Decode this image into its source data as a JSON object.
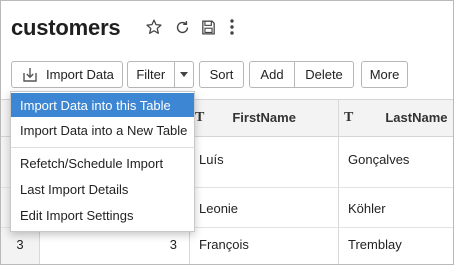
{
  "header": {
    "title": "customers",
    "icons": [
      "star-icon",
      "refresh-icon",
      "save-icon",
      "more-vertical-icon"
    ]
  },
  "toolbar": {
    "import_label": "Import Data",
    "filter_label": "Filter",
    "sort_label": "Sort",
    "add_label": "Add",
    "delete_label": "Delete",
    "more_label": "More"
  },
  "import_menu": {
    "items": [
      {
        "label": "Import Data into this Table",
        "selected": true
      },
      {
        "label": "Import Data into a New Table",
        "selected": false
      },
      {
        "label": "Refetch/Schedule Import",
        "selected": false
      },
      {
        "label": "Last Import Details",
        "selected": false
      },
      {
        "label": "Edit Import Settings",
        "selected": false
      }
    ]
  },
  "table": {
    "columns": [
      {
        "type_glyph": "T",
        "label": "FirstName"
      },
      {
        "type_glyph": "T",
        "label": "LastName"
      }
    ],
    "rows": [
      {
        "row_number": "",
        "id": "",
        "first": "Luís",
        "last": "Gonçalves"
      },
      {
        "row_number": "",
        "id": "",
        "first": "Leonie",
        "last": "Köhler"
      },
      {
        "row_number": "3",
        "id": "3",
        "first": "François",
        "last": "Tremblay"
      }
    ]
  },
  "colors": {
    "accent": "#3d86d3",
    "header_bg": "#f3f3f3",
    "border": "#b7b7b7"
  }
}
